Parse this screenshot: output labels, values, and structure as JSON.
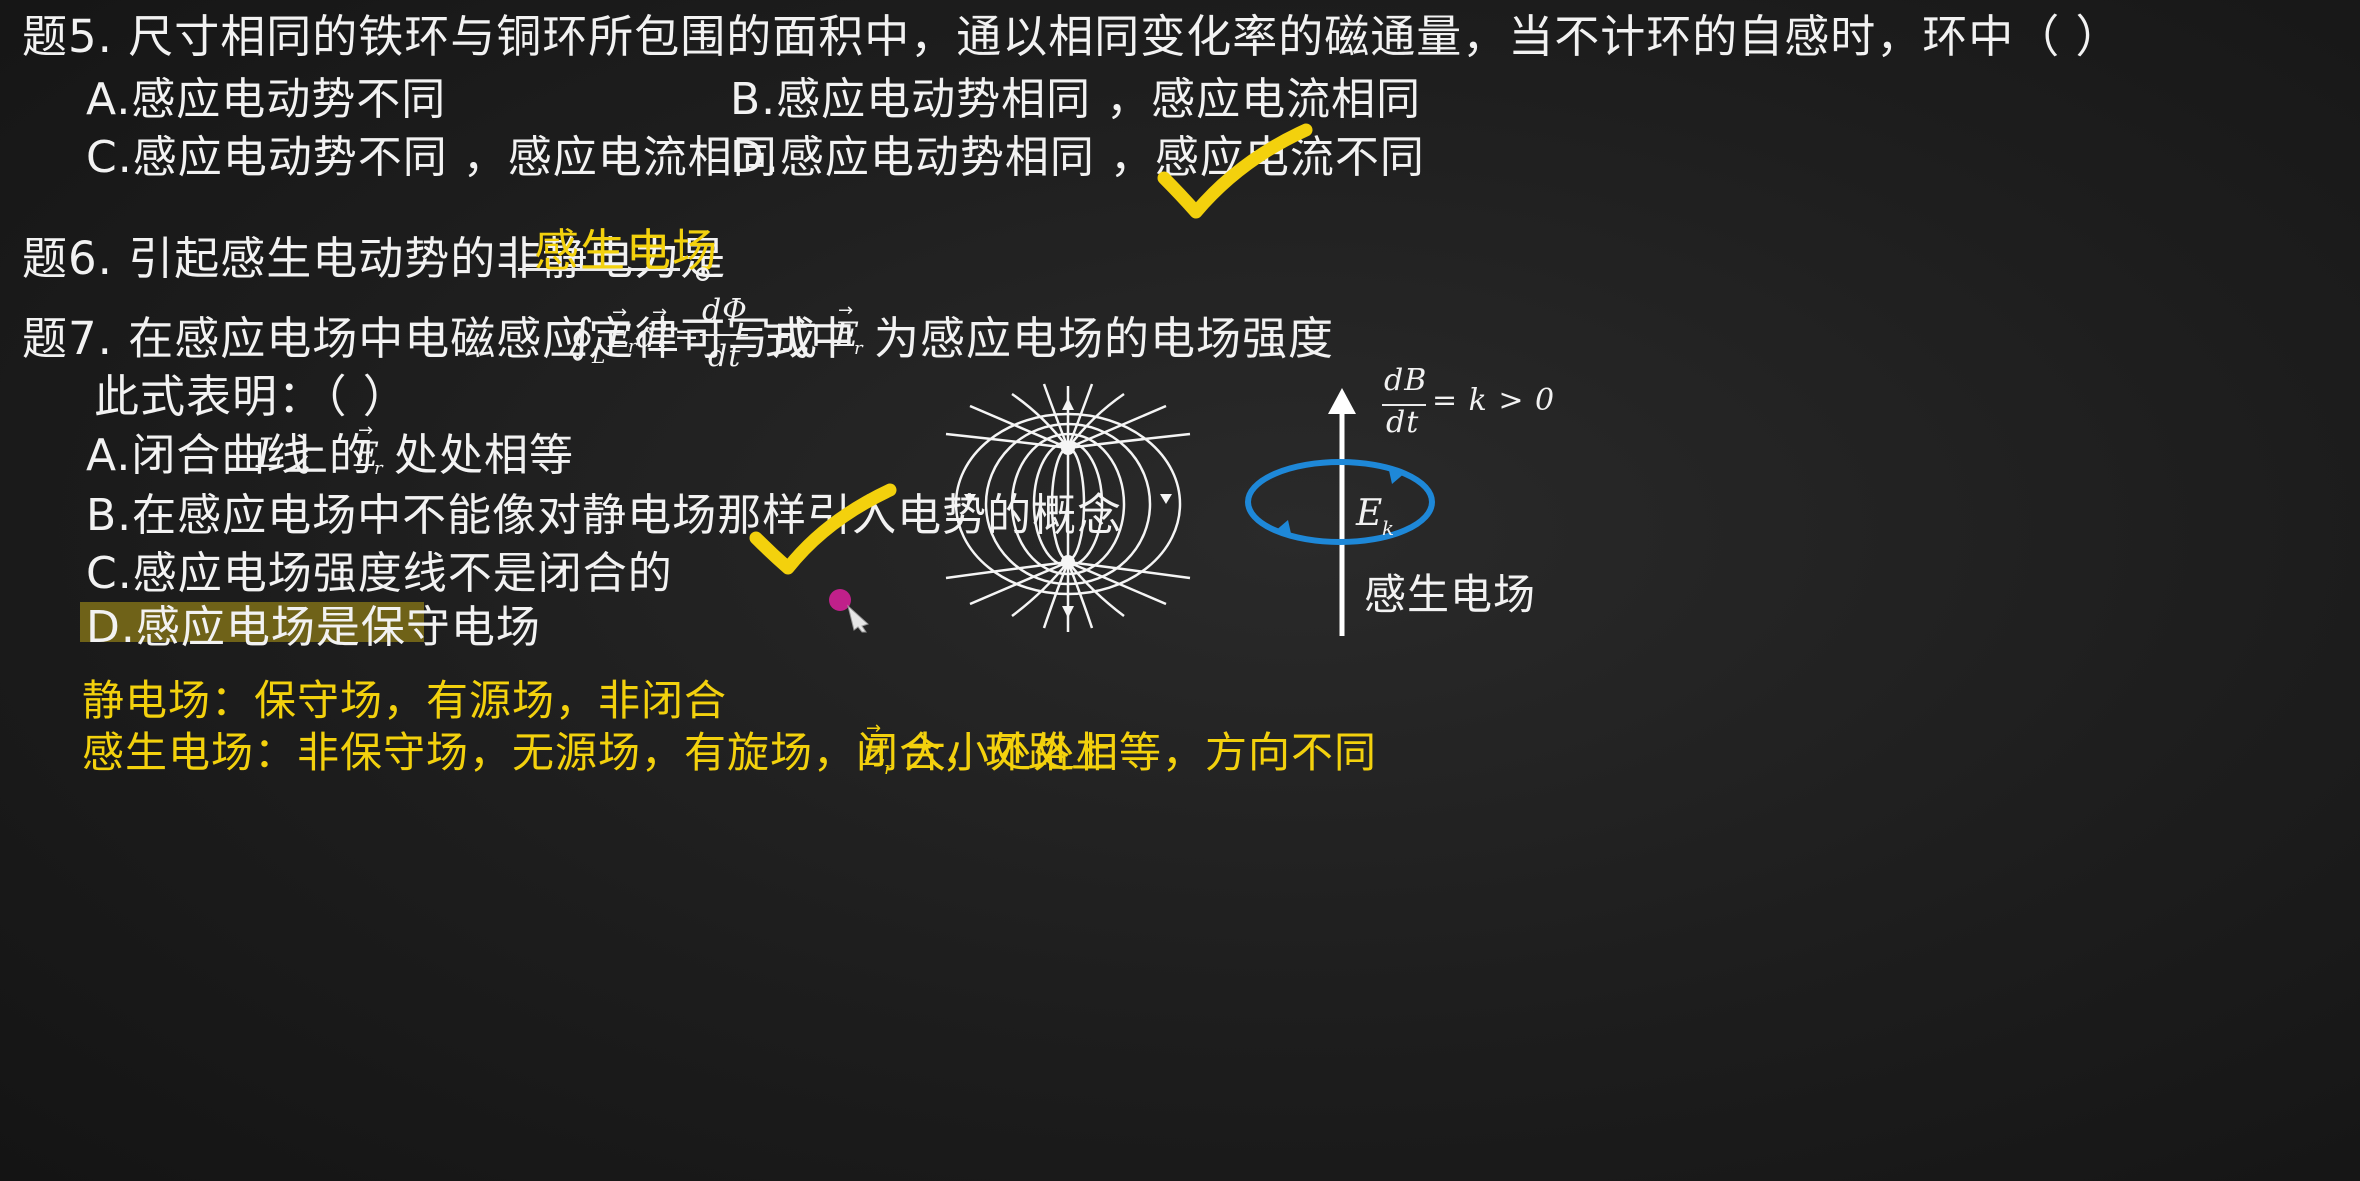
{
  "q5": {
    "stem": "题5. 尺寸相同的铁环与铜环所包围的面积中，通以相同变化率的磁通量，当不计环的自感时，环中（  ）",
    "option_a": "A.感应电动势不同",
    "option_b": "B.感应电动势相同 ，感应电流相同",
    "option_c": "C.感应电动势不同 ，感应电流相同",
    "option_d": "D.感应电动势相同 ，感应电流不同"
  },
  "q6": {
    "stem": "题6. 引起感生电动势的非静电力是",
    "answer": "感生电场",
    "end": "。"
  },
  "q7": {
    "stem_prefix": "题7. 在感应电场中电磁感应定律可写成",
    "formula_lhs": "∮",
    "formula_sub": "L",
    "formula_E": "E",
    "formula_r": "r",
    "formula_dl": "dl",
    "formula_eq": "=",
    "formula_num": "dΦ",
    "formula_den": "dt",
    "stem_middle": "式中",
    "stem_suffix": "为感应电场的电场强度",
    "stem_line2": "此式表明：（      ）",
    "option_a_prefix": "A.闭合曲线",
    "option_a_L": "L",
    "option_a_mid": "上的",
    "option_a_suffix": "处处相等",
    "option_b": "B.在感应电场中不能像对静电场那样引入电势的概念",
    "option_c": "C.感应电场强度线不是闭合的",
    "option_d": "D.感应电场是保守电场"
  },
  "diagram": {
    "rate_num": "dB",
    "rate_den": "dt",
    "rate_rhs": "= k > 0",
    "ek_E": "E",
    "ek_k": "k",
    "field_label": "感生电场"
  },
  "summary": {
    "line1": "静电场：保守场，有源场，非闭合",
    "line2_prefix": "感生电场：非保守场，无源场，有旋场，闭合，环路上",
    "line2_suffix": "大小处处相等，方向不同"
  },
  "colors": {
    "chalk_white": "#f2f2f2",
    "chalk_yellow": "#f3d10d",
    "loop_blue": "#1e88d8",
    "highlight": "#6f6218",
    "pointer_magenta": "#c0208a"
  }
}
